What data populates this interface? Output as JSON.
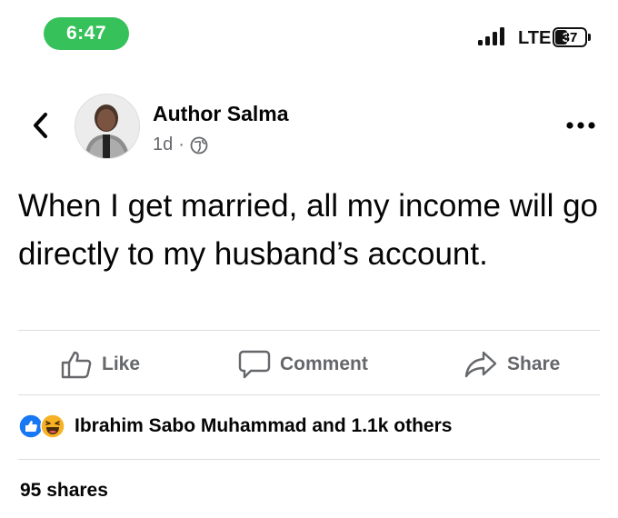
{
  "status_bar": {
    "time": "6:47",
    "network": "LTE",
    "battery": "37",
    "battery_level": 0.37
  },
  "post": {
    "author": "Author Salma",
    "age": "1d",
    "separator": "·",
    "audience_icon": "globe-icon",
    "text": "When I get married, all my income will go directly to my husband’s account."
  },
  "actions": {
    "like": "Like",
    "comment": "Comment",
    "share": "Share"
  },
  "reactions": {
    "icons": [
      "like-reaction-icon",
      "haha-reaction-icon"
    ],
    "summary": "Ibrahim Sabo Muhammad and 1.1k others"
  },
  "shares": "95 shares",
  "colors": {
    "time_pill": "#36c15a",
    "like_blue": "#1877f2",
    "haha_yellow": "#f7b125",
    "secondary_text": "#65676b"
  }
}
